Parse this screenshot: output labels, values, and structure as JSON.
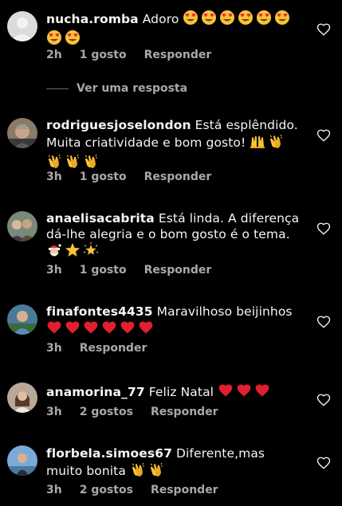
{
  "comments": [
    {
      "username": "nucha.romba",
      "text": "Adoro",
      "time": "2h",
      "likes": "1 gosto",
      "reply": "Responder",
      "emoji_icons": [
        "heart-eyes-emoji",
        "heart-eyes-emoji",
        "heart-eyes-emoji",
        "heart-eyes-emoji",
        "heart-eyes-emoji",
        "heart-eyes-emoji",
        "heart-eyes-emoji",
        "heart-eyes-emoji"
      ]
    },
    {
      "username": "rodriguesjoselondon",
      "text": "Está esplêndido. Muita criatividade e bom gosto!",
      "time": "3h",
      "likes": "1 gosto",
      "reply": "Responder",
      "emoji_icons": [
        "raising-hands-emoji",
        "clapping-hands-emoji",
        "clapping-hands-emoji",
        "clapping-hands-emoji",
        "clapping-hands-emoji"
      ]
    },
    {
      "username": "anaelisacabrita",
      "text": "Está linda. A diferença dá-lhe alegria e o bom gosto é o tema.",
      "time": "3h",
      "likes": "1 gosto",
      "reply": "Responder",
      "emoji_icons": [
        "santa-emoji",
        "star-emoji",
        "glowing-star-emoji"
      ]
    },
    {
      "username": "finafontes4435",
      "text": "Maravilhoso beijinhos",
      "time": "3h",
      "likes": "",
      "reply": "Responder",
      "emoji_icons": [
        "red-heart-emoji",
        "red-heart-emoji",
        "red-heart-emoji",
        "red-heart-emoji",
        "red-heart-emoji",
        "red-heart-emoji"
      ]
    },
    {
      "username": "anamorina_77",
      "text": "Feliz Natal",
      "time": "3h",
      "likes": "2 gostos",
      "reply": "Responder",
      "emoji_icons": [
        "red-heart-emoji",
        "red-heart-emoji",
        "red-heart-emoji"
      ]
    },
    {
      "username": "florbela.simoes67",
      "text": "Diferente,mas muito bonita",
      "time": "3h",
      "likes": "2 gostos",
      "reply": "Responder",
      "emoji_icons": [
        "clapping-hands-emoji",
        "clapping-hands-emoji"
      ]
    }
  ],
  "view_replies": "Ver uma resposta",
  "colors": {
    "background": "#000000",
    "text": "#f5f5f5",
    "secondary": "#a8a8a8",
    "heart_emoji": "#e0202e",
    "emoji_face": "#f7c338"
  }
}
